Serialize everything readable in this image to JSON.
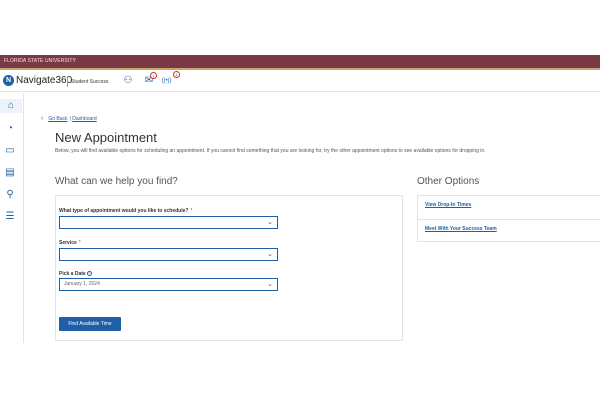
{
  "top_bar": {
    "university": "FLORIDA STATE UNIVERSITY"
  },
  "header": {
    "logo_glyph": "N",
    "brand": "Navigate360",
    "product": "Student Success",
    "icons": [
      {
        "name": "people-icon",
        "glyph": "⚇"
      },
      {
        "name": "mail-icon",
        "glyph": "✉",
        "badge": "1"
      },
      {
        "name": "broadcast-icon",
        "glyph": "((•))",
        "badge": "1"
      }
    ]
  },
  "sidebar": {
    "items": [
      {
        "name": "home-icon",
        "glyph": "⌂"
      },
      {
        "name": "dashboard-gauge-icon",
        "glyph": "◔"
      },
      {
        "name": "messages-icon",
        "glyph": "▭"
      },
      {
        "name": "calendar-card-icon",
        "glyph": "▤"
      },
      {
        "name": "search-icon",
        "glyph": "⚲"
      },
      {
        "name": "list-icon",
        "glyph": "☰"
      }
    ]
  },
  "breadcrumb": {
    "back_label": "Go Back",
    "separator": "|",
    "dashboard_label": "Dashboard"
  },
  "page": {
    "title": "New Appointment",
    "description": "Below, you will find available options for scheduling an appointment. If you cannot find something that you are looking for, try the other appointment options to see available options for dropping in."
  },
  "form": {
    "heading": "What can we help you find?",
    "type_label": "What type of appointment would you like to schedule?",
    "type_value": "",
    "service_label": "Service",
    "service_value": "",
    "required_marker": "*",
    "date_label": "Pick a Date",
    "date_value": "January 1, 2024",
    "submit_label": "Find Available Time"
  },
  "other_options": {
    "heading": "Other Options",
    "links": [
      "View Drop-In Times",
      "Meet With Your Success Team"
    ]
  },
  "colors": {
    "garnet": "#7a3a45",
    "gold": "#c9a36b",
    "primary_blue": "#1f5fa8",
    "required_red": "#c0392b"
  }
}
